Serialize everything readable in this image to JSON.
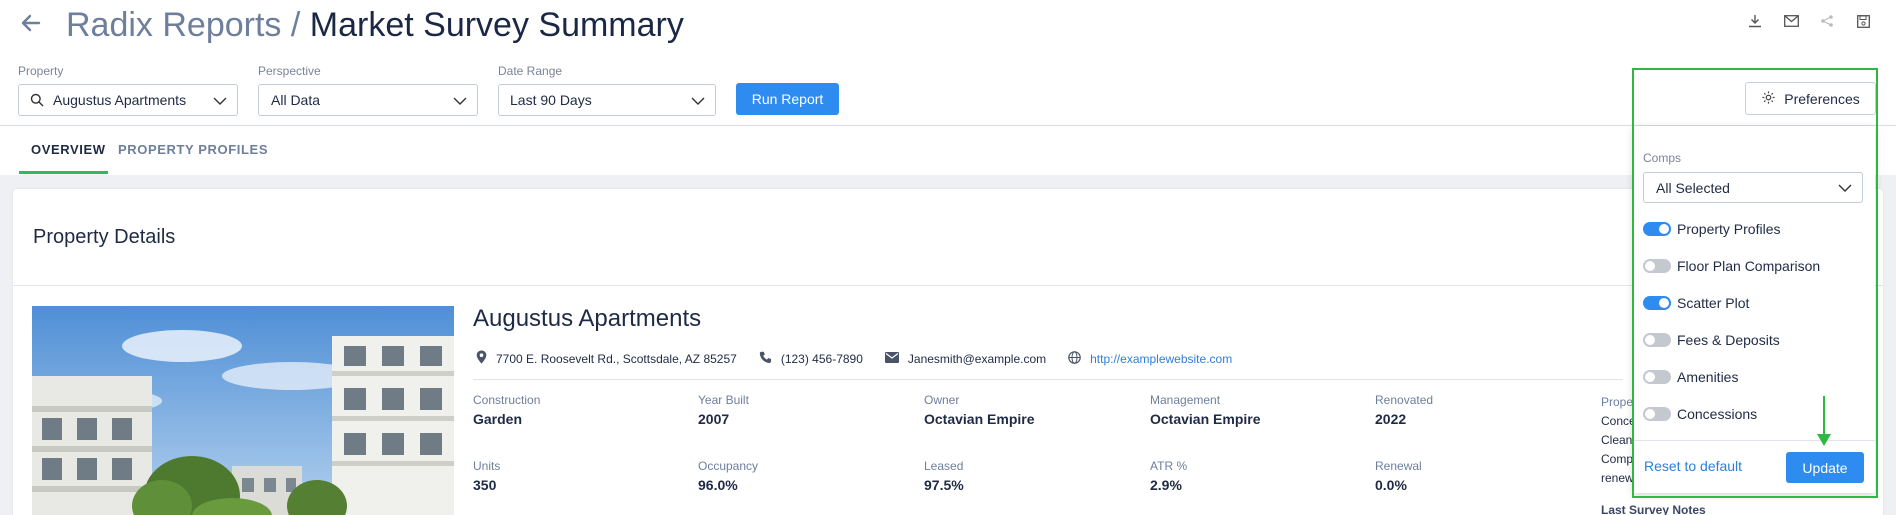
{
  "header": {
    "breadcrumb_parent": "Radix Reports",
    "separator": "/",
    "title": "Market Survey Summary",
    "icons": [
      "download-icon",
      "mail-icon",
      "share-icon",
      "save-icon"
    ]
  },
  "filters": {
    "property": {
      "label": "Property",
      "value": "Augustus Apartments"
    },
    "perspective": {
      "label": "Perspective",
      "value": "All Data"
    },
    "date_range": {
      "label": "Date Range",
      "value": "Last 90 Days"
    },
    "run_label": "Run Report"
  },
  "preferences_label": "Preferences",
  "tabs": [
    {
      "label": "OVERVIEW",
      "active": true
    },
    {
      "label": "PROPERTY PROFILES",
      "active": false
    }
  ],
  "section_title": "Property Details",
  "property": {
    "name": "Augustus Apartments",
    "address": "7700 E. Roosevelt Rd., Scottsdale, AZ 85257",
    "phone": "(123) 456-7890",
    "email": "Janesmith@example.com",
    "website": "http://examplewebsite.com",
    "fields_row1": [
      {
        "label": "Construction",
        "value": "Garden"
      },
      {
        "label": "Year Built",
        "value": "2007"
      },
      {
        "label": "Owner",
        "value": "Octavian Empire"
      },
      {
        "label": "Management",
        "value": "Octavian Empire"
      },
      {
        "label": "Renovated",
        "value": "2022"
      }
    ],
    "fields_row2": [
      {
        "label": "Units",
        "value": "350"
      },
      {
        "label": "Occupancy",
        "value": "96.0%"
      },
      {
        "label": "Leased",
        "value": "97.5%"
      },
      {
        "label": "ATR %",
        "value": "2.9%"
      },
      {
        "label": "Renewal",
        "value": "0.0%"
      }
    ],
    "side_label": "Prope",
    "side_lines": [
      "Conce",
      "Clean",
      "Comp",
      "renew"
    ],
    "last_survey_notes": "Last Survey Notes"
  },
  "pref_panel": {
    "comps_label": "Comps",
    "comps_value": "All Selected",
    "toggles": [
      {
        "label": "Property Profiles",
        "on": true
      },
      {
        "label": "Floor Plan Comparison",
        "on": false
      },
      {
        "label": "Scatter Plot",
        "on": true
      },
      {
        "label": "Fees & Deposits",
        "on": false
      },
      {
        "label": "Amenities",
        "on": false
      },
      {
        "label": "Concessions",
        "on": false
      }
    ],
    "reset_label": "Reset to default",
    "update_label": "Update"
  },
  "colors": {
    "accent": "#2e8bf0",
    "annotation": "#2fb842",
    "tab_underline": "#2fb866"
  }
}
